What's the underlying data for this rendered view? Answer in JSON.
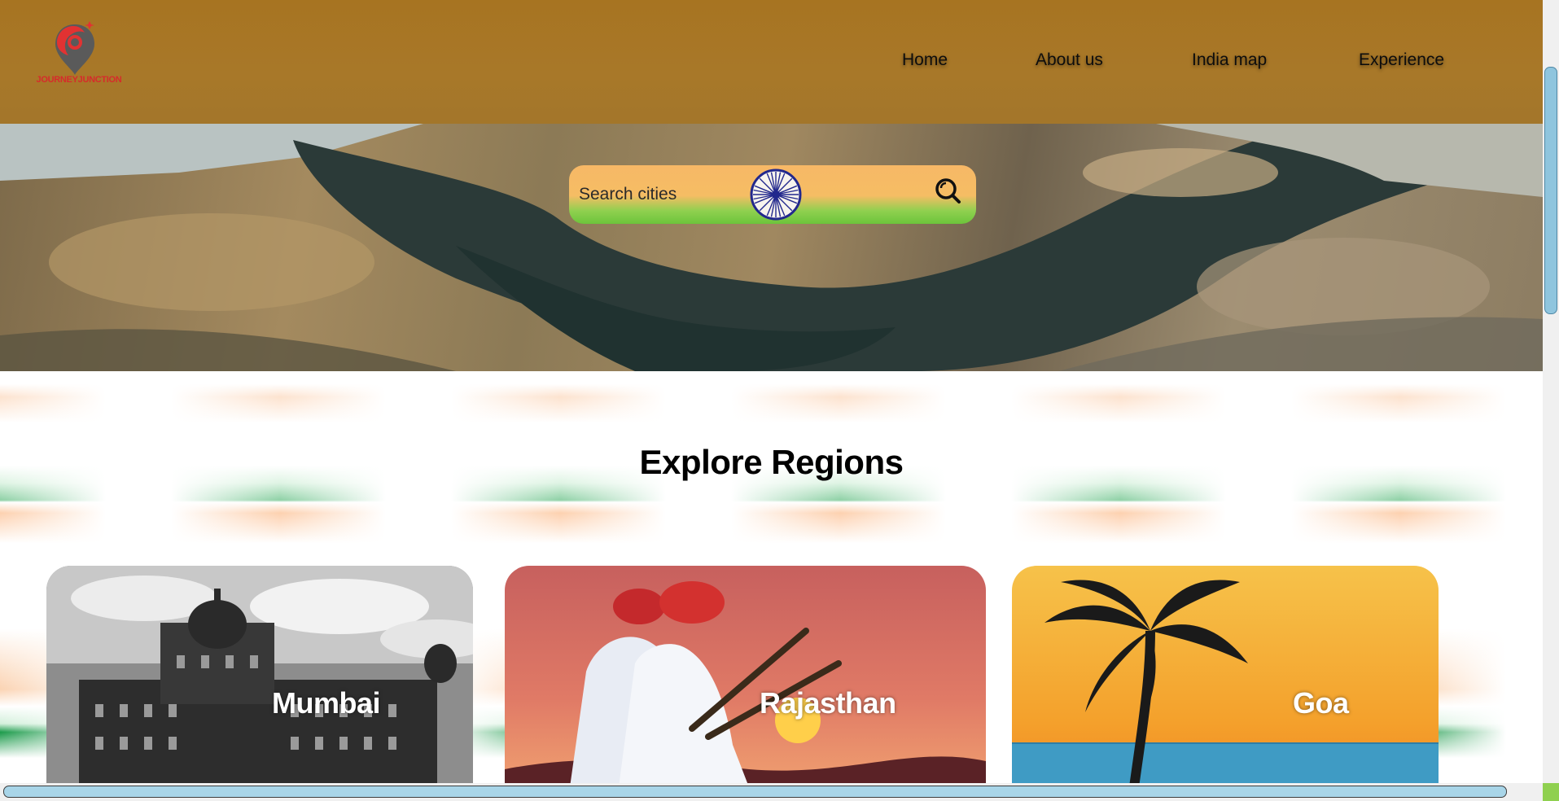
{
  "brand": {
    "name": "JOURNEYJUNCTION",
    "logo_icon": "map-pin-icon"
  },
  "nav": [
    {
      "label": "Home"
    },
    {
      "label": "About us"
    },
    {
      "label": "India map"
    },
    {
      "label": "Experience"
    }
  ],
  "search": {
    "placeholder": "Search cities",
    "icon": "search-icon",
    "emblem": "ashoka-chakra-icon"
  },
  "explore": {
    "title": "Explore Regions",
    "regions": [
      {
        "label": "Mumbai"
      },
      {
        "label": "Rajasthan"
      },
      {
        "label": "Goa"
      }
    ]
  },
  "colors": {
    "header": "#a77421",
    "saffron": "#f5bd64",
    "green": "#6cc43b",
    "scroll_thumb": "#8fc5de"
  }
}
